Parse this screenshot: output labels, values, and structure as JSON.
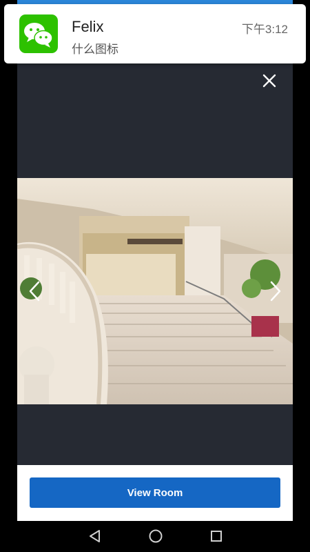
{
  "notification": {
    "app_icon": "wechat-icon",
    "sender": "Felix",
    "message": "什么图标",
    "time": "下午3:12"
  },
  "viewer": {
    "close_icon": "close-icon",
    "prev_icon": "chevron-left-icon",
    "next_icon": "chevron-right-icon",
    "photo_subject": "hotel-lobby-staircase"
  },
  "actions": {
    "view_room_label": "View Room"
  },
  "system_nav": {
    "back_icon": "back-triangle-icon",
    "home_icon": "home-circle-icon",
    "recents_icon": "recents-square-icon"
  },
  "colors": {
    "wechat_green": "#2dc100",
    "button_blue": "#1567c4",
    "viewer_background": "#262a33"
  }
}
